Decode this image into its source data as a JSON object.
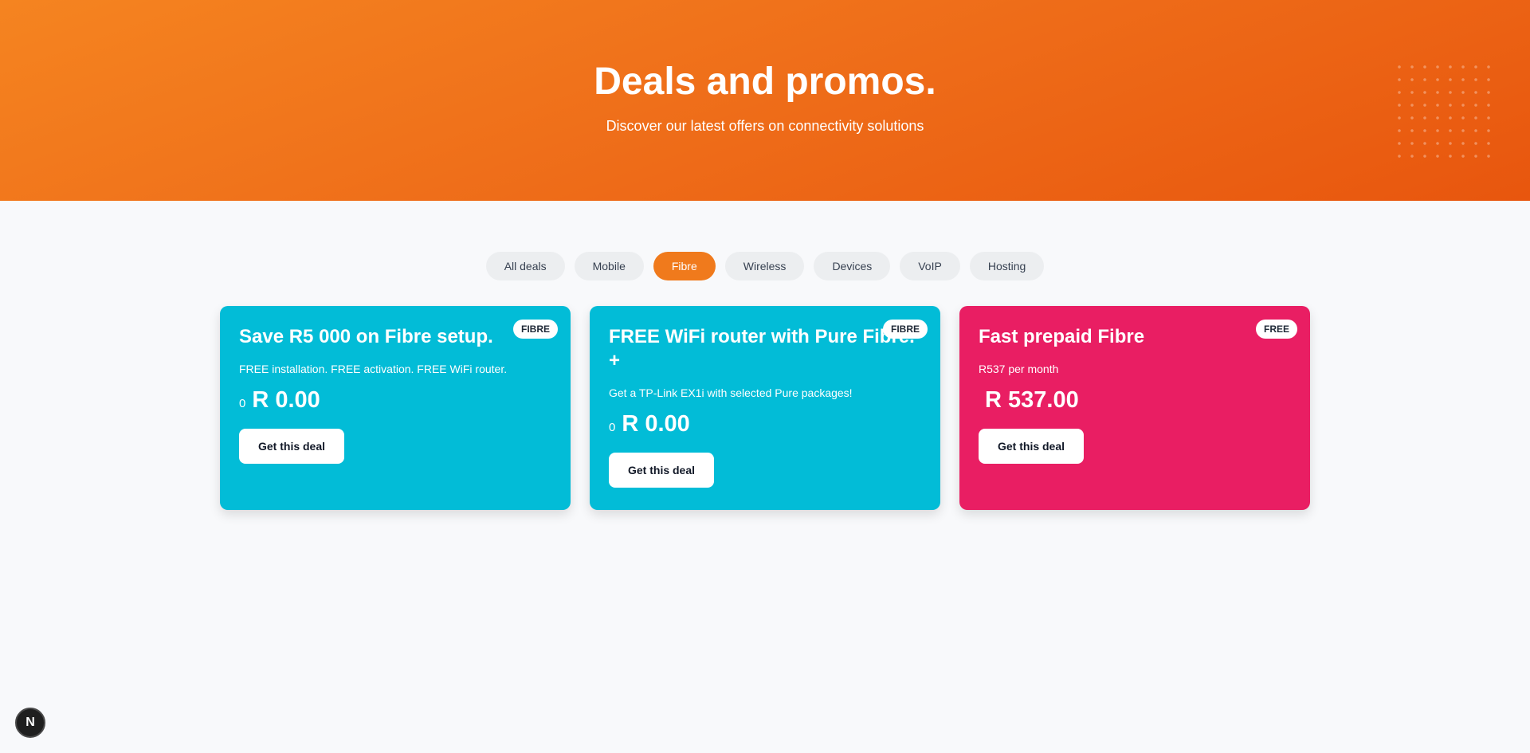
{
  "hero": {
    "title": "Deals and promos.",
    "subtitle": "Discover our latest offers on connectivity solutions"
  },
  "filters": [
    {
      "label": "All deals",
      "active": false
    },
    {
      "label": "Mobile",
      "active": false
    },
    {
      "label": "Fibre",
      "active": true
    },
    {
      "label": "Wireless",
      "active": false
    },
    {
      "label": "Devices",
      "active": false
    },
    {
      "label": "VoIP",
      "active": false
    },
    {
      "label": "Hosting",
      "active": false
    }
  ],
  "deals": [
    {
      "title": "Save R5 000 on Fibre setup.",
      "badge": "FIBRE",
      "description": "FREE installation. FREE activation. FREE WiFi router.",
      "price_prefix": "0",
      "price": "R 0.00",
      "button": "Get this deal",
      "color": "#02bcd7"
    },
    {
      "title": "FREE WiFi router with Pure Fibre. +",
      "badge": "FIBRE",
      "description": "Get a TP-Link EX1i with selected Pure packages!",
      "price_prefix": "0",
      "price": "R 0.00",
      "button": "Get this deal",
      "color": "#02bcd7"
    },
    {
      "title": "Fast prepaid Fibre",
      "badge": "FREE",
      "description": "R537 per month",
      "price_prefix": "",
      "price": "R 537.00",
      "button": "Get this deal",
      "color": "#e91e63"
    }
  ],
  "fab": {
    "label": "N"
  },
  "colors": {
    "accent": "#f07a1c",
    "hero_start": "#f58420",
    "hero_end": "#e8560e"
  }
}
